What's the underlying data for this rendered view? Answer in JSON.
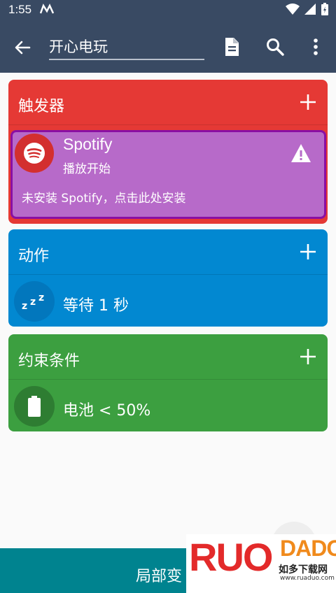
{
  "status": {
    "time": "1:55"
  },
  "toolbar": {
    "title": "开心电玩"
  },
  "triggers": {
    "header": "触发器",
    "item": {
      "name": "Spotify",
      "subtitle": "播放开始",
      "note": "未安装 Spotify，点击此处安装"
    }
  },
  "actions": {
    "header": "动作",
    "item": {
      "text": "等待 1 秒",
      "icon_text": "zzz"
    }
  },
  "constraints": {
    "header": "约束条件",
    "item": {
      "text": "电池 < 50%"
    }
  },
  "bottom": {
    "label": "局部变"
  },
  "watermark": {
    "brand_left": "RUO",
    "brand_right": "DADO",
    "cn": "如多下载网",
    "url": "www.ruaduo.com"
  },
  "colors": {
    "toolbar": "#394a63",
    "trigger": "#e53935",
    "trigger_item": "#b76ac9",
    "action": "#0288d1",
    "constraint": "#3c9f40",
    "bottom": "#00838f"
  }
}
